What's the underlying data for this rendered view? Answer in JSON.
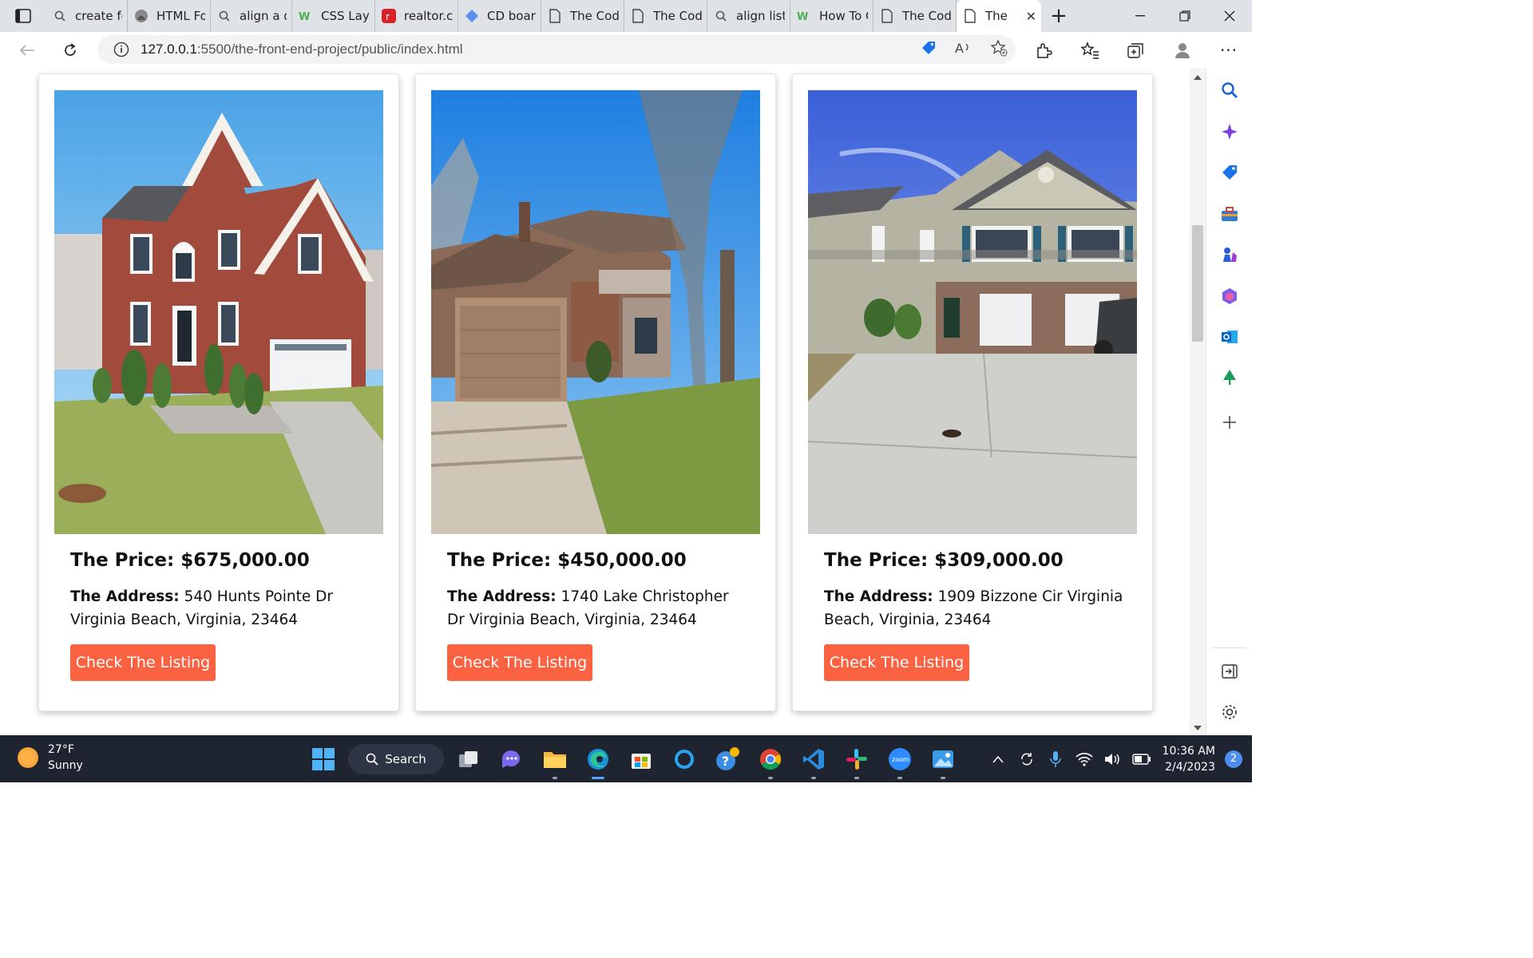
{
  "browser": {
    "tabs": [
      {
        "title": "create fo",
        "icon": "search-icon"
      },
      {
        "title": "HTML Fo",
        "icon": "site-icon"
      },
      {
        "title": "align a d",
        "icon": "search-icon"
      },
      {
        "title": "CSS Layo",
        "icon": "w3-icon"
      },
      {
        "title": "realtor.co",
        "icon": "realtor-icon"
      },
      {
        "title": "CD boarc",
        "icon": "diamond-icon"
      },
      {
        "title": "The Codi",
        "icon": "page-icon"
      },
      {
        "title": "The Codi",
        "icon": "page-icon"
      },
      {
        "title": "align list",
        "icon": "search-icon"
      },
      {
        "title": "How To C",
        "icon": "w3-icon"
      },
      {
        "title": "The Codi",
        "icon": "page-icon"
      },
      {
        "title": "The",
        "icon": "page-icon",
        "active": true
      }
    ],
    "url_host": "127.0.0.1",
    "url_path": ":5500/the-front-end-project/public/index.html"
  },
  "listings": [
    {
      "price": "The Price: $675,000.00",
      "address_label": "The Address:",
      "address": "540 Hunts Pointe Dr Virginia Beach, Virginia, 23464",
      "button": "Check The Listing",
      "photo": "red-brick-two-story-house"
    },
    {
      "price": "The Price: $450,000.00",
      "address_label": "The Address:",
      "address": "1740 Lake Christopher Dr Virginia Beach, Virginia, 23464",
      "button": "Check The Listing",
      "photo": "brown-house-with-garage-and-tree"
    },
    {
      "price": "The Price: $309,000.00",
      "address_label": "The Address:",
      "address": "1909 Bizzone Cir Virginia Beach, Virginia, 23464",
      "button": "Check The Listing",
      "photo": "townhouses-with-driveway"
    }
  ],
  "taskbar": {
    "temperature": "27°F",
    "condition": "Sunny",
    "search_label": "Search",
    "time": "10:36 AM",
    "date": "2/4/2023",
    "notification_count": "2"
  },
  "colors": {
    "button": "#fb6242",
    "taskbar": "#1e2430"
  }
}
